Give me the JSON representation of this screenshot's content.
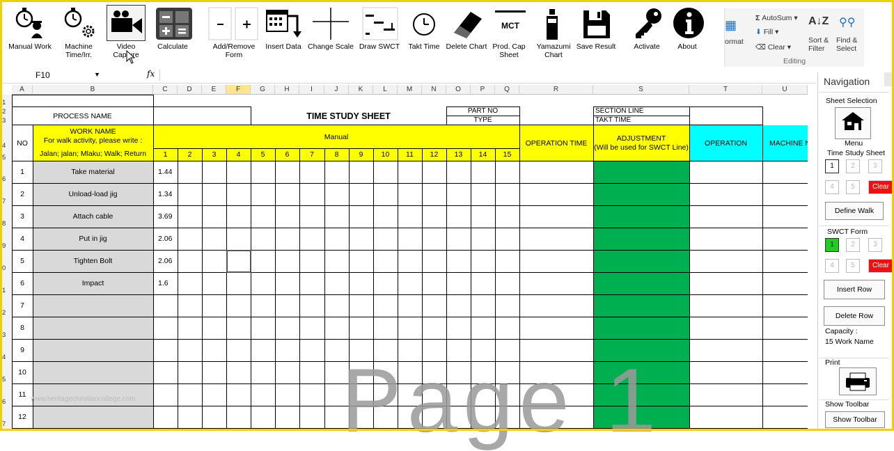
{
  "ribbon": {
    "buttons": [
      {
        "label": "Manual Work",
        "icon": "stopwatch-worker-icon"
      },
      {
        "label": "Machine\nTime/Irr.",
        "icon": "stopwatch-gear-icon"
      },
      {
        "label": "Video\nCapture",
        "icon": "video-camera-icon"
      },
      {
        "label": "Calculate",
        "icon": "calculator-icon"
      },
      {
        "label": "Add/Remove\nForm",
        "icon": "minus-plus-icon"
      },
      {
        "label": "Insert Data",
        "icon": "calendar-arrow-icon"
      },
      {
        "label": "Change Scale",
        "icon": "crosshair-icon"
      },
      {
        "label": "Draw SWCT",
        "icon": "gantt-icon"
      },
      {
        "label": "Takt Time",
        "icon": "clock-icon"
      },
      {
        "label": "Delete Chart",
        "icon": "eraser-icon"
      },
      {
        "label": "Prod. Cap\nSheet",
        "icon": "mct-icon"
      },
      {
        "label": "Yamazumi\nChart",
        "icon": "stack-chart-icon"
      },
      {
        "label": "Save Result",
        "icon": "floppy-disk-icon"
      },
      {
        "label": "Activate",
        "icon": "key-icon"
      },
      {
        "label": "About",
        "icon": "info-icon"
      }
    ],
    "mct_text": "MCT",
    "editing": {
      "autosum": "AutoSum",
      "fill": "Fill",
      "clear": "Clear",
      "sort": "Sort &\nFilter",
      "find": "Find &\nSelect",
      "format": "ormat",
      "group": "Editing"
    }
  },
  "formula_bar": {
    "name_box": "F10",
    "fx": "fx",
    "value": ""
  },
  "columns": [
    "A",
    "B",
    "C",
    "D",
    "E",
    "F",
    "G",
    "H",
    "I",
    "J",
    "K",
    "L",
    "M",
    "N",
    "O",
    "P",
    "Q",
    "R",
    "S",
    "T",
    "U"
  ],
  "active_column": "F",
  "row_numbers": [
    "1",
    "2",
    "3",
    "4",
    "5",
    "6",
    "7",
    "8",
    "9",
    "0",
    "1",
    "2",
    "3",
    "4",
    "5",
    "6",
    "7"
  ],
  "sheet": {
    "process_name": "PROCESS NAME",
    "title": "TIME STUDY SHEET",
    "part_no": "PART NO",
    "type": "TYPE",
    "section_line": "SECTION LINE",
    "takt_time": "TAKT TIME",
    "no_header": "NO",
    "work_name": "WORK NAME",
    "work_name_note": "For walk activity, please write :",
    "work_name_examples": "Jalan; jalan; Mlaku; Walk; Return",
    "manual": "Manual",
    "operation_time": "OPERATION TIME",
    "adjustment": "ADJUSTMENT",
    "adjustment_note": "(Will be used for SWCT Line)",
    "operation": "OPERATION",
    "machine": "MACHINE N",
    "cycle_numbers": [
      "1",
      "2",
      "3",
      "4",
      "5",
      "6",
      "7",
      "8",
      "9",
      "10",
      "11",
      "12",
      "13",
      "14",
      "15"
    ],
    "rows": [
      {
        "no": "1",
        "work": "Take material",
        "c1": "1.44"
      },
      {
        "no": "2",
        "work": "Unload-load jig",
        "c1": "1.34"
      },
      {
        "no": "3",
        "work": "Attach cable",
        "c1": "3.69"
      },
      {
        "no": "4",
        "work": "Put in jig",
        "c1": "2.06"
      },
      {
        "no": "5",
        "work": "Tighten Bolt",
        "c1": "2.06"
      },
      {
        "no": "6",
        "work": "Impact",
        "c1": "1.6"
      },
      {
        "no": "7",
        "work": "",
        "c1": ""
      },
      {
        "no": "8",
        "work": "",
        "c1": ""
      },
      {
        "no": "9",
        "work": "",
        "c1": ""
      },
      {
        "no": "10",
        "work": "",
        "c1": ""
      },
      {
        "no": "11",
        "work": "",
        "c1": ""
      },
      {
        "no": "12",
        "work": "",
        "c1": ""
      }
    ],
    "watermark": "Page 1",
    "site_watermark": "www.heritagechristiancollege.com"
  },
  "navigation": {
    "title": "Navigation",
    "sheet_selection": "Sheet Selection",
    "menu": "Menu",
    "time_study_sheet": "Time Study Sheet",
    "tss_buttons": [
      "1",
      "2",
      "3",
      "4",
      "5"
    ],
    "clear": "Clear",
    "define_walk": "Define Walk",
    "swct_form": "SWCT Form",
    "swct_buttons": [
      "1",
      "2",
      "3",
      "4",
      "5"
    ],
    "insert_row": "Insert Row",
    "delete_row": "Delete Row",
    "capacity_label": "Capacity :",
    "capacity_value": "15 Work Name",
    "print": "Print",
    "show_toolbar_label": "Show Toolbar",
    "show_toolbar_button": "Show Toolbar"
  },
  "colors": {
    "yellow": "#ffff00",
    "cyan": "#00ffff",
    "green": "#00b050",
    "gray": "#d9d9d9",
    "red": "#ee1111",
    "frame": "#f0d000"
  }
}
